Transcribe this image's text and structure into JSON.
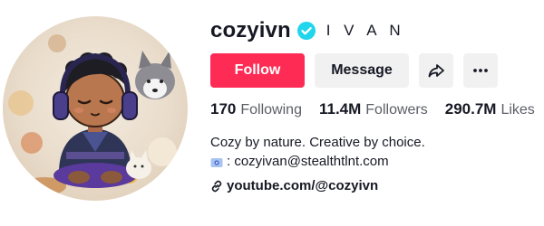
{
  "profile": {
    "username": "cozyivn",
    "nickname": "I V A N",
    "verified": true
  },
  "actions": {
    "follow_label": "Follow",
    "message_label": "Message",
    "share_icon": "share-arrow-icon",
    "more_icon": "more-horizontal-icon"
  },
  "stats": [
    {
      "value": "170",
      "label": "Following"
    },
    {
      "value": "11.4M",
      "label": "Followers"
    },
    {
      "value": "290.7M",
      "label": "Likes"
    }
  ],
  "bio": {
    "line1": "Cozy by nature. Creative by choice.",
    "line2": ": cozyivan@stealthtlnt.com",
    "line2_icon": "email-emoji-icon"
  },
  "link": {
    "icon": "link-icon",
    "text": "youtube.com/@cozyivn"
  },
  "colors": {
    "follow_bg": "#fe2c55",
    "button_bg": "#f1f1f2",
    "verified_badge": "#20d5ec",
    "secondary_text": "#5c5e66"
  }
}
